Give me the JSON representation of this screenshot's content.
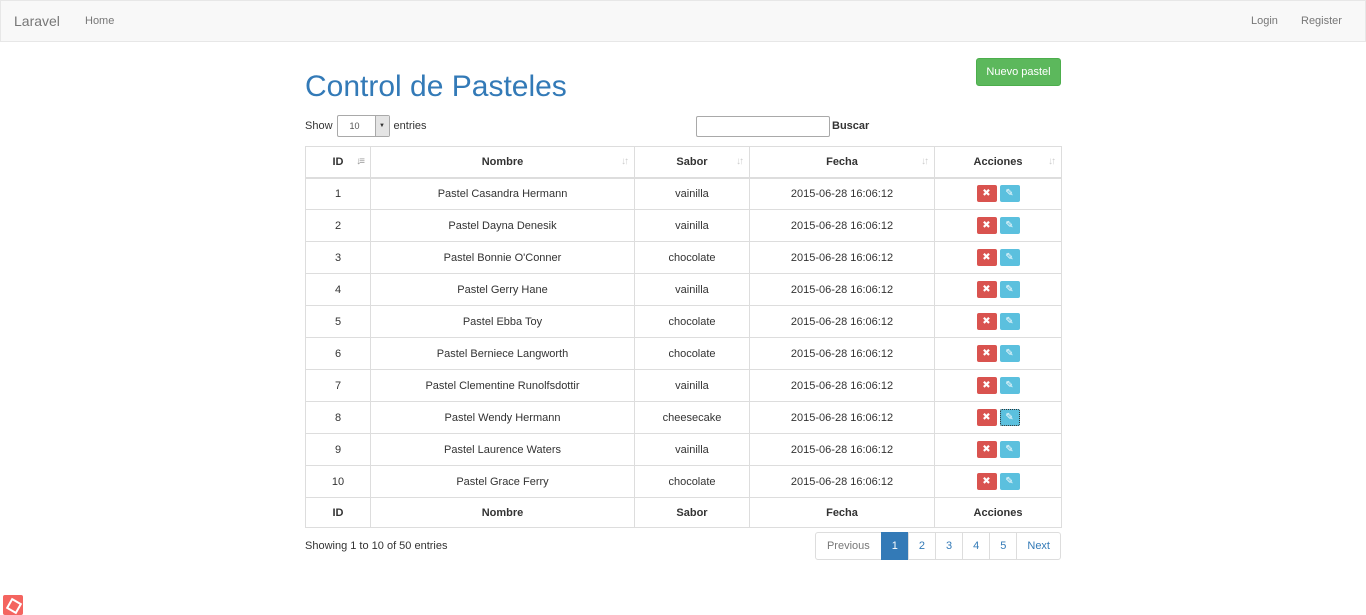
{
  "navbar": {
    "brand": "Laravel",
    "links": {
      "home": "Home",
      "login": "Login",
      "register": "Register"
    }
  },
  "page": {
    "title": "Control de Pasteles",
    "new_button": "Nuevo pastel"
  },
  "length_menu": {
    "show_label": "Show",
    "selected": "10",
    "entries_label": "entries"
  },
  "search": {
    "label": "Buscar",
    "value": ""
  },
  "table": {
    "columns": [
      "ID",
      "Nombre",
      "Sabor",
      "Fecha",
      "Acciones"
    ],
    "sorted_column": "ID",
    "rows": [
      {
        "id": "1",
        "nombre": "Pastel Casandra Hermann",
        "sabor": "vainilla",
        "fecha": "2015-06-28 16:06:12"
      },
      {
        "id": "2",
        "nombre": "Pastel Dayna Denesik",
        "sabor": "vainilla",
        "fecha": "2015-06-28 16:06:12"
      },
      {
        "id": "3",
        "nombre": "Pastel Bonnie O'Conner",
        "sabor": "chocolate",
        "fecha": "2015-06-28 16:06:12"
      },
      {
        "id": "4",
        "nombre": "Pastel Gerry Hane",
        "sabor": "vainilla",
        "fecha": "2015-06-28 16:06:12"
      },
      {
        "id": "5",
        "nombre": "Pastel Ebba Toy",
        "sabor": "chocolate",
        "fecha": "2015-06-28 16:06:12"
      },
      {
        "id": "6",
        "nombre": "Pastel Berniece Langworth",
        "sabor": "chocolate",
        "fecha": "2015-06-28 16:06:12"
      },
      {
        "id": "7",
        "nombre": "Pastel Clementine Runolfsdottir",
        "sabor": "vainilla",
        "fecha": "2015-06-28 16:06:12"
      },
      {
        "id": "8",
        "nombre": "Pastel Wendy Hermann",
        "sabor": "cheesecake",
        "fecha": "2015-06-28 16:06:12"
      },
      {
        "id": "9",
        "nombre": "Pastel Laurence Waters",
        "sabor": "vainilla",
        "fecha": "2015-06-28 16:06:12"
      },
      {
        "id": "10",
        "nombre": "Pastel Grace Ferry",
        "sabor": "chocolate",
        "fecha": "2015-06-28 16:06:12"
      }
    ],
    "row_actions": {
      "delete_icon": "remove-icon",
      "edit_icon": "edit-icon"
    },
    "focused_edit_row": "8"
  },
  "info": "Showing 1 to 10 of 50 entries",
  "pagination": {
    "previous": "Previous",
    "pages": [
      "1",
      "2",
      "3",
      "4",
      "5"
    ],
    "current": "1",
    "next": "Next"
  },
  "colors": {
    "primary": "#337ab7",
    "success": "#5cb85c",
    "danger": "#d9534f",
    "info": "#5bc0de"
  }
}
